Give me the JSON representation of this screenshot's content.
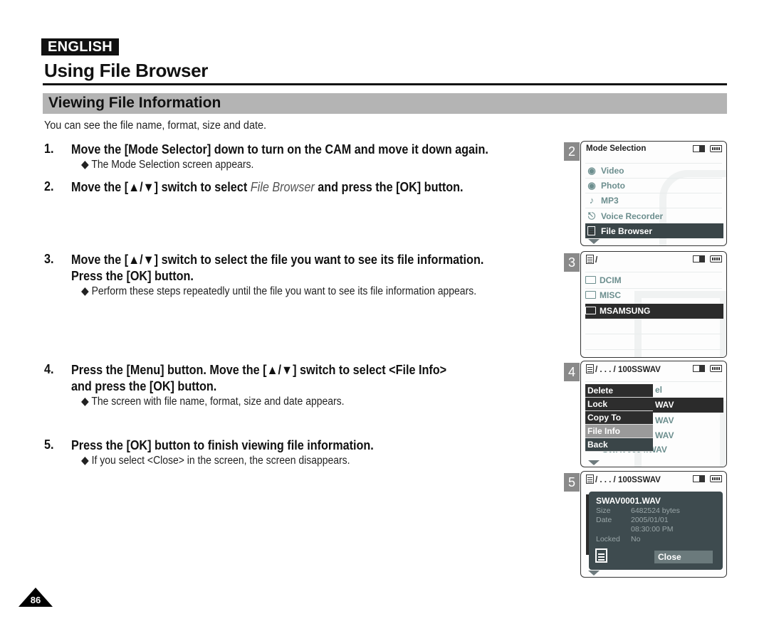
{
  "header": {
    "language": "ENGLISH",
    "title": "Using File Browser",
    "section": "Viewing File Information",
    "intro": "You can see the file name, format, size and date."
  },
  "steps": [
    {
      "num": "1.",
      "lines": [
        "Move the [Mode Selector] down to turn on the CAM and move it down again."
      ],
      "note": "◆ The Mode Selection screen appears."
    },
    {
      "num": "2.",
      "pre": "Move the [▲/▼] switch to select ",
      "em": "File Browser",
      "post": " and press the [OK] button."
    },
    {
      "num": "3.",
      "lines": [
        "Move the [▲/▼] switch to select the file you want to see its file information.",
        "Press the [OK] button."
      ],
      "note": "◆ Perform these steps repeatedly until the file you want to see its file information appears."
    },
    {
      "num": "4.",
      "lines": [
        "Press the [Menu] button. Move the [▲/▼] switch to select <File Info>",
        "and press the [OK] button."
      ],
      "note": "◆ The screen with file name, format, size and date appears."
    },
    {
      "num": "5.",
      "lines": [
        "Press the [OK] button to finish viewing file information."
      ],
      "note": "◆ If you select <Close> in the screen, the screen disappears."
    }
  ],
  "screens": {
    "s2": {
      "num": "2",
      "title": "Mode Selection",
      "items": [
        {
          "label": "Video",
          "icon": "video-camera-icon"
        },
        {
          "label": "Photo",
          "icon": "camera-icon"
        },
        {
          "label": "MP3",
          "icon": "music-note-icon"
        },
        {
          "label": "Voice Recorder",
          "icon": "microphone-icon"
        },
        {
          "label": "File Browser",
          "icon": "file-browser-icon",
          "selected": true
        }
      ]
    },
    "s3": {
      "num": "3",
      "path": "/",
      "folders": [
        "DCIM",
        "MISC",
        "MSAMSUNG"
      ],
      "selected": "MSAMSUNG"
    },
    "s4": {
      "num": "4",
      "path": "/ . . . / 100SSWAV",
      "bg_files": [
        "el",
        "WAV",
        "WAV",
        "WAV",
        "SWAV0004.WAV"
      ],
      "menu": [
        "Delete",
        "Lock",
        "Copy To",
        "File Info",
        "Back"
      ],
      "highlighted": "File Info"
    },
    "s5": {
      "num": "5",
      "path": "/ . . . / 100SSWAV",
      "file_name": "SWAV0001.WAV",
      "size_label": "Size",
      "size_value": "6482524 bytes",
      "date_label": "Date",
      "date_value": "2005/01/01",
      "time_value": "08:30:00 PM",
      "locked_label": "Locked",
      "locked_value": "No",
      "close_label": "Close"
    }
  },
  "footer": {
    "page_number": "86"
  }
}
